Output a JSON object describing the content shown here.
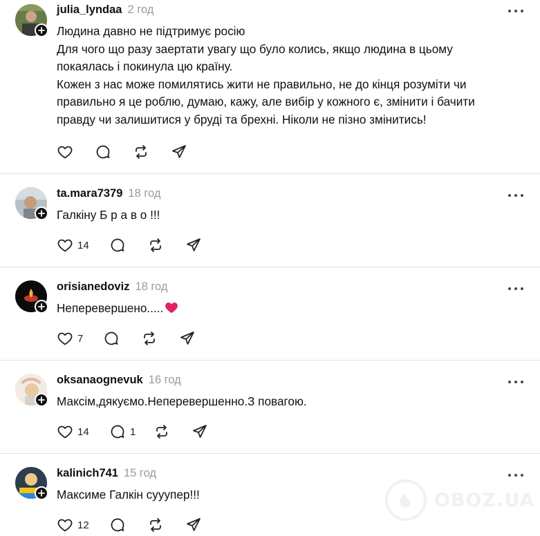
{
  "posts": [
    {
      "username": "julia_lyndaa",
      "time": "2 год",
      "lines": [
        "Людина давно не підтримує росію",
        "Для чого що разу заертати увагу що було колись, якщо людина в цьому",
        "покаялась і покинула цю країну.",
        "Кожен з нас може помилятись жити не правильно, не до кінця розуміти чи",
        "правильно я це роблю, думаю, кажу, але вибір у кожного є, змінити і бачити",
        "правду чи залишитися у бруді та брехні. Ніколи не пізно змінитись!"
      ],
      "likes": "",
      "replies": ""
    },
    {
      "username": "ta.mara7379",
      "time": "18 год",
      "lines": [
        "Галкіну Б р а в о !!!"
      ],
      "likes": "14",
      "replies": ""
    },
    {
      "username": "orisianedoviz",
      "time": "18 год",
      "lines": [
        "Неперевершено....."
      ],
      "emoji": "red-heart",
      "likes": "7",
      "replies": ""
    },
    {
      "username": "oksanaognevuk",
      "time": "16 год",
      "lines": [
        "Максім,дякуємо.Неперевершенно.З повагою."
      ],
      "likes": "14",
      "replies": "1"
    },
    {
      "username": "kalinich741",
      "time": "15 год",
      "lines": [
        "Максиме Галкін сууупер!!!"
      ],
      "likes": "12",
      "replies": ""
    }
  ],
  "icons": {
    "like": "heart-outline-icon",
    "reply": "speech-bubble-icon",
    "repost": "repost-arrows-icon",
    "share": "paper-plane-icon",
    "more": "more-dots-icon",
    "follow": "plus-badge-icon"
  },
  "colors": {
    "text": "#101010",
    "muted": "#9a9a9a",
    "divider": "#e3e3e3",
    "heart_emoji": "#e0245e"
  },
  "watermark": {
    "text": "OBOZ.UA"
  }
}
